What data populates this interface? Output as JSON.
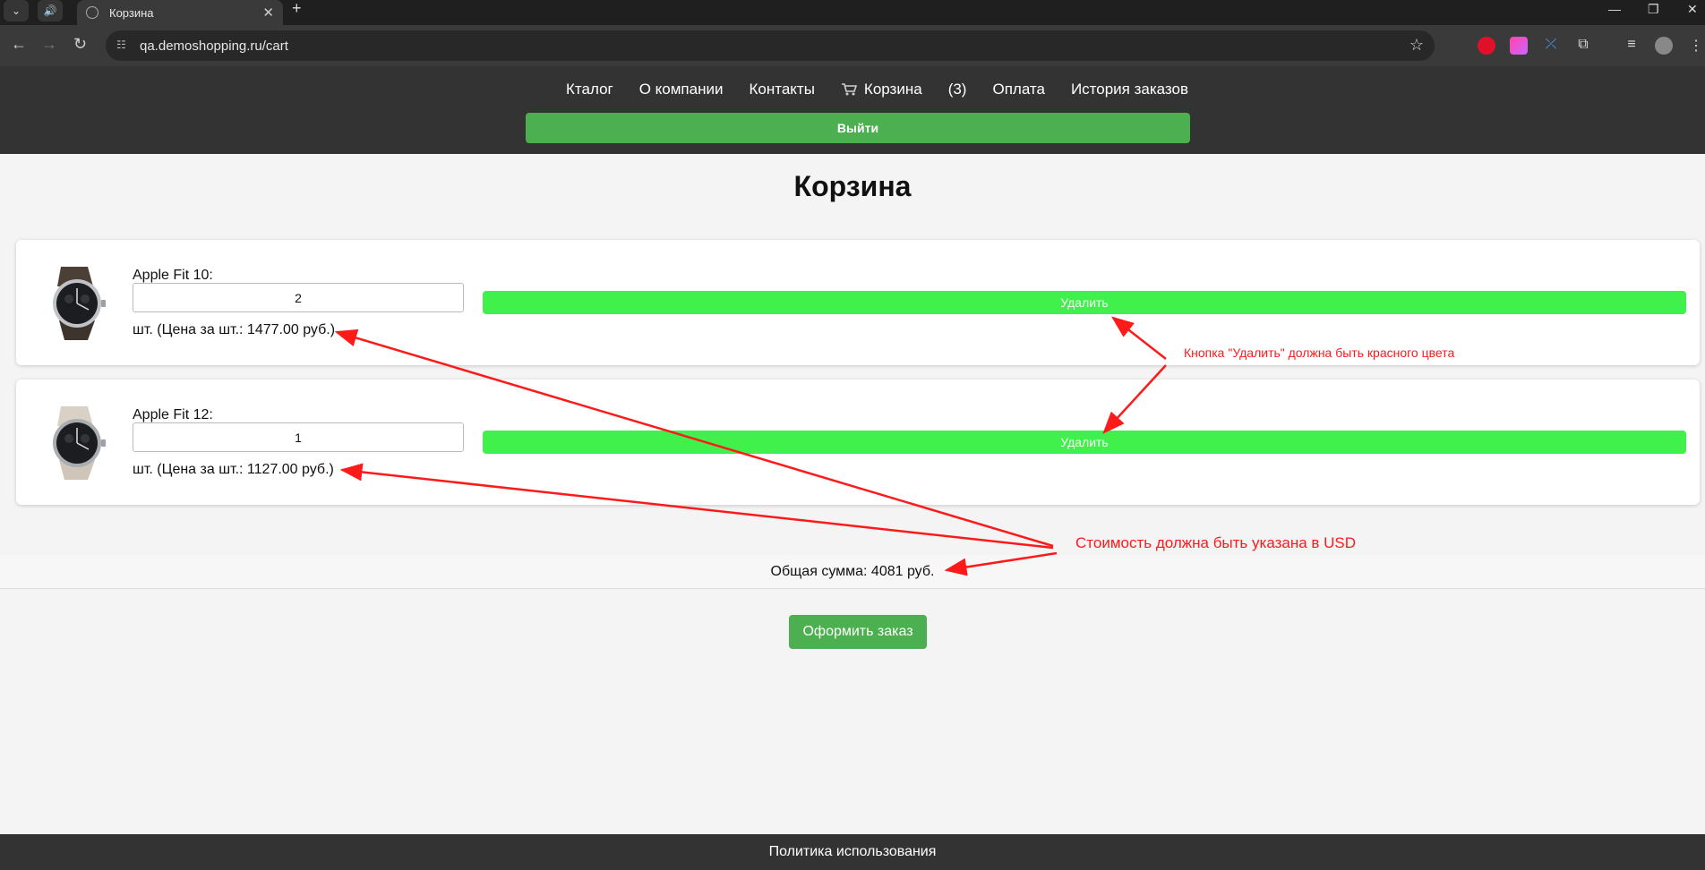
{
  "browser": {
    "tab_title": "Корзина",
    "url": "qa.demoshopping.ru/cart"
  },
  "nav": {
    "items": [
      "Кталог",
      "О компании",
      "Контакты"
    ],
    "cart_label": "Корзина",
    "cart_count": "(3)",
    "items_after": [
      "Оплата",
      "История заказов"
    ],
    "logout_label": "Выйти"
  },
  "page": {
    "title": "Корзина"
  },
  "cart": {
    "items": [
      {
        "name": "Apple Fit 10:",
        "quantity": "2",
        "price_text": "шт. (Цена за шт.: 1477.00 руб.)",
        "remove_label": "Удалить"
      },
      {
        "name": "Apple Fit 12:",
        "quantity": "1",
        "price_text": "шт. (Цена за шт.: 1127.00 руб.)",
        "remove_label": "Удалить"
      }
    ],
    "total_text": "Общая сумма: 4081 руб.",
    "order_label": "Оформить заказ"
  },
  "footer": {
    "link": "Политика использования"
  },
  "annotations": {
    "remove_note": "Кнопка \"Удалить\" должна быть красного цвета",
    "currency_note": "Стоимость должна быть указана в USD",
    "arrow_color": "#ff1a1a"
  },
  "colors": {
    "header_bg": "#333333",
    "primary_green": "#4caf50",
    "remove_green": "#3ff14a"
  }
}
